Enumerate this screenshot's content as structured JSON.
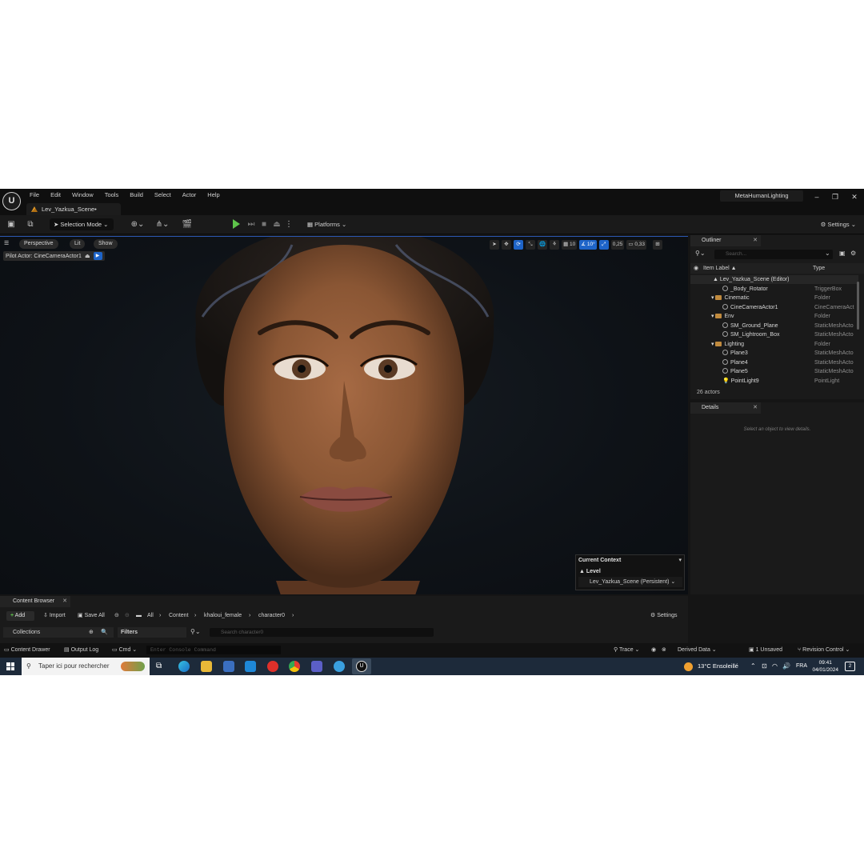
{
  "titlebar": {
    "menu": [
      "File",
      "Edit",
      "Window",
      "Tools",
      "Build",
      "Select",
      "Actor",
      "Help"
    ],
    "doc_tab": "Lev_Yazkua_Scene•",
    "project": "MetaHumanLighting",
    "minimize": "–",
    "restore": "❐",
    "close": "✕"
  },
  "toolbar": {
    "selection_mode": "Selection Mode",
    "platforms": "Platforms",
    "settings": "Settings"
  },
  "viewport": {
    "perspective": "Perspective",
    "lit": "Lit",
    "show": "Show",
    "pilot_actor": "Pilot Actor: CineCameraActor1",
    "grid_snap": "10",
    "rot_snap": "10°",
    "scale_snap": "0,25",
    "cam_speed": "0,33",
    "context": {
      "title": "Current Context",
      "level_label": "Level",
      "level_value": "Lev_Yazkua_Scene (Persistent)"
    }
  },
  "outliner": {
    "tab": "Outliner",
    "search_placeholder": "Search...",
    "col_label": "Item Label ▲",
    "col_type": "Type",
    "rows": [
      {
        "label": "Lev_Yazkua_Scene (Editor)",
        "type": ""
      },
      {
        "label": "_Body_Rotator",
        "type": "TriggerBox"
      },
      {
        "label": "Cinematic",
        "type": "Folder"
      },
      {
        "label": "CineCameraActor1",
        "type": "CineCameraAct"
      },
      {
        "label": "Env",
        "type": "Folder"
      },
      {
        "label": "SM_Ground_Plane",
        "type": "StaticMeshActo"
      },
      {
        "label": "SM_Lightroom_Box",
        "type": "StaticMeshActo"
      },
      {
        "label": "Lighting",
        "type": "Folder"
      },
      {
        "label": "Plane3",
        "type": "StaticMeshActo"
      },
      {
        "label": "Plane4",
        "type": "StaticMeshActo"
      },
      {
        "label": "Plane5",
        "type": "StaticMeshActo"
      },
      {
        "label": "PointLight9",
        "type": "PointLight"
      }
    ],
    "actor_count": "26 actors"
  },
  "details": {
    "tab": "Details",
    "empty": "Select an object to view details."
  },
  "content_browser": {
    "tab": "Content Browser",
    "add": "Add",
    "import": "Import",
    "save_all": "Save All",
    "path": [
      "All",
      "Content",
      "khaloui_female",
      "character0"
    ],
    "settings": "Settings",
    "collections": "Collections",
    "filters": "Filters",
    "search_placeholder": "Search character0"
  },
  "statusbar": {
    "content_drawer": "Content Drawer",
    "output_log": "Output Log",
    "cmd": "Cmd",
    "console_placeholder": "Enter Console Command",
    "trace": "Trace",
    "derived_data": "Derived Data",
    "unsaved": "1 Unsaved",
    "revision_control": "Revision Control"
  },
  "taskbar": {
    "search": "Taper ici pour rechercher",
    "weather": "13°C  Ensoleillé",
    "lang": "FRA",
    "time": "09:41",
    "date": "04/01/2024",
    "notif": "2"
  }
}
